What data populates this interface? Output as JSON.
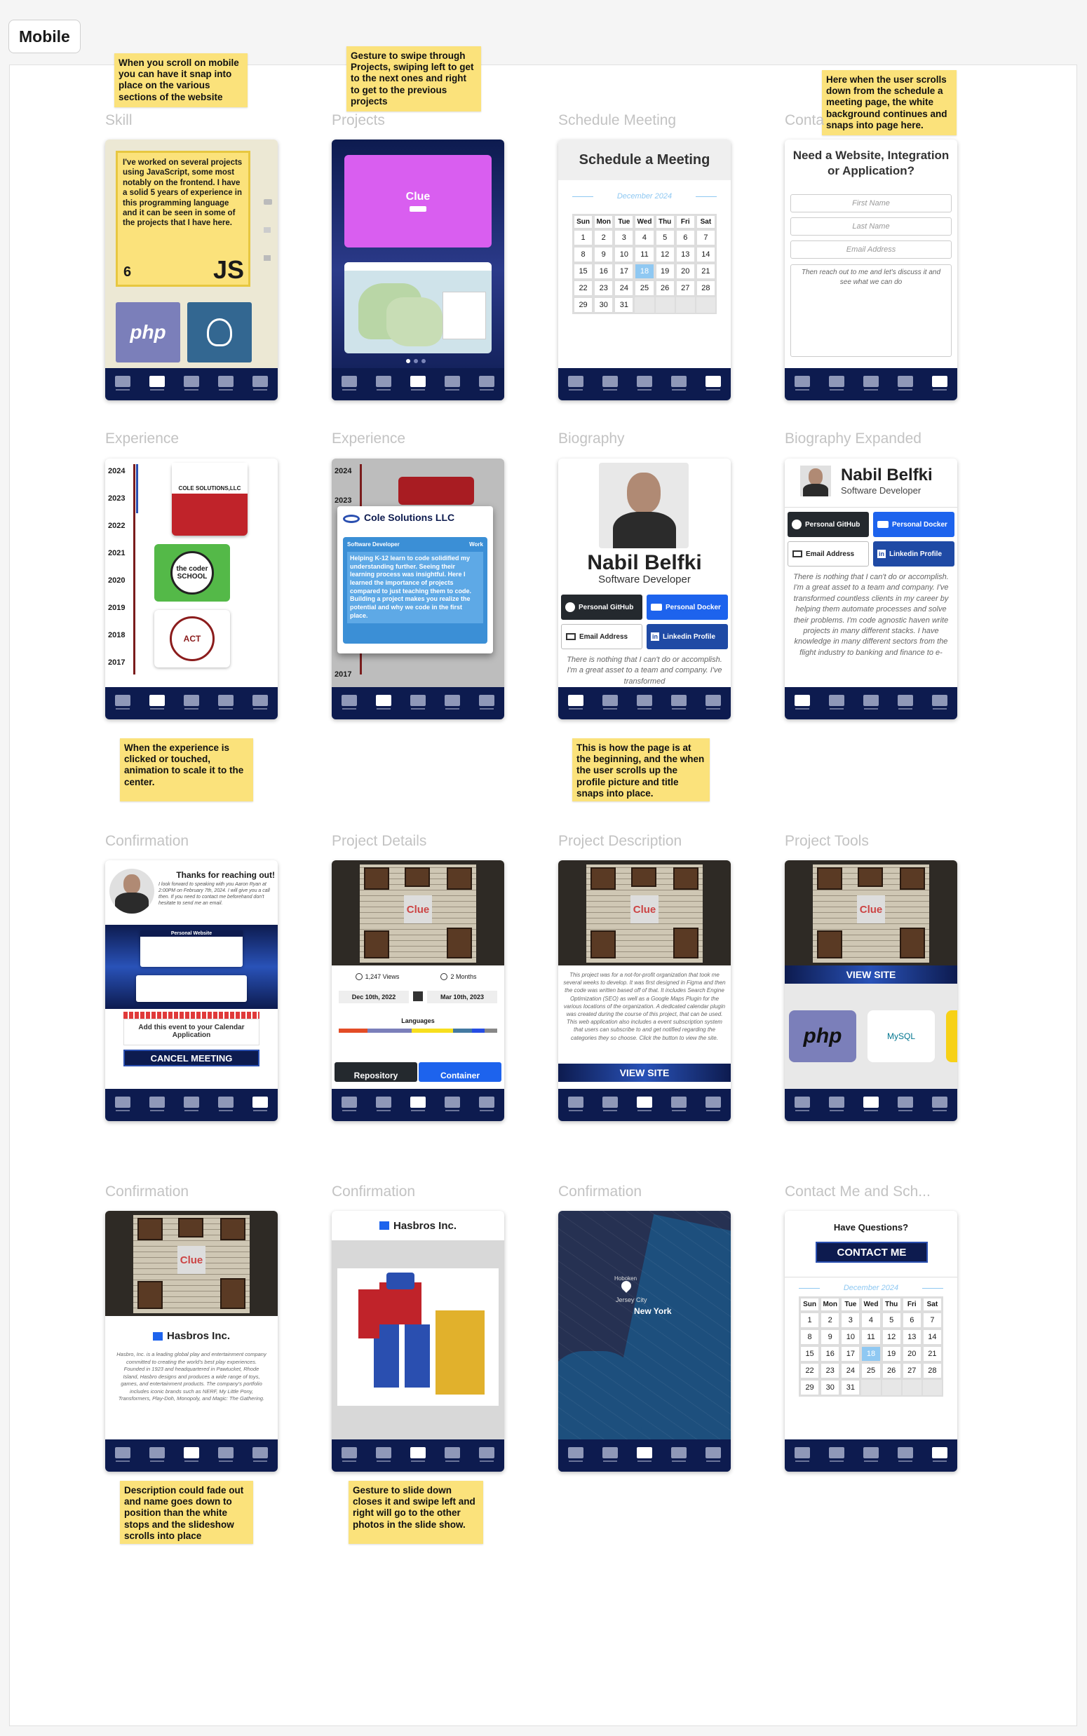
{
  "page_label": "Mobile",
  "nav_labels": [
    "BIOGRAPHY",
    "EXPERIENCE",
    "PROJECTS",
    "MEETING",
    "CONTACT"
  ],
  "frames": [
    {
      "title": "Skill"
    },
    {
      "title": "Projects"
    },
    {
      "title": "Schedule Meeting"
    },
    {
      "title": "Contact"
    },
    {
      "title": "Experience"
    },
    {
      "title": "Experience"
    },
    {
      "title": "Biography"
    },
    {
      "title": "Biography Expanded"
    },
    {
      "title": "Confirmation"
    },
    {
      "title": "Project Details"
    },
    {
      "title": "Project Description"
    },
    {
      "title": "Project Tools"
    },
    {
      "title": "Confirmation"
    },
    {
      "title": "Confirmation"
    },
    {
      "title": "Confirmation"
    },
    {
      "title": "Contact Me and Sch..."
    }
  ],
  "notes": {
    "snap": "When you scroll on mobile you can have it snap into place on the various sections of the website",
    "swipe": "Gesture to swipe through Projects, swiping left to get to the next ones and right to get to the previous projects",
    "contact_scroll": "Here when the user scrolls down from the schedule a meeting page, the white background continues and snaps into page here.",
    "experience": "When the experience is clicked or touched, animation to scale it to the center.",
    "biography": "This is how the page is at the beginning, and the when the user scrolls up the profile picture and title snaps into place.",
    "description": "Description could fade out and name goes down to position than the white stops and the slideshow scrolls into place",
    "slideshow": "Gesture to slide down closes it and swipe left and right will go to the other photos in the slide show."
  },
  "skill": {
    "text": "I've worked on several projects using JavaScript, some most notably on the frontend. I have a solid 5 years of experience in this programming language and it can be seen in some of the projects that I have here.",
    "count": "6",
    "badge": "JS",
    "tiles": [
      "php",
      "postgres-elephant"
    ]
  },
  "projects": {
    "card_title": "Clue"
  },
  "schedule": {
    "title": "Schedule a Meeting",
    "month": "December 2024",
    "days": [
      "Sun",
      "Mon",
      "Tue",
      "Wed",
      "Thu",
      "Fri",
      "Sat"
    ],
    "dates": [
      "1",
      "2",
      "3",
      "4",
      "5",
      "6",
      "7",
      "8",
      "9",
      "10",
      "11",
      "12",
      "13",
      "14",
      "15",
      "16",
      "17",
      "18",
      "19",
      "20",
      "21",
      "22",
      "23",
      "24",
      "25",
      "26",
      "27",
      "28",
      "29",
      "30",
      "31",
      "",
      "",
      "",
      ""
    ],
    "today": "18"
  },
  "contact": {
    "title": "Need a Website, Integration or Application?",
    "first_name": "First Name",
    "last_name": "Last Name",
    "email": "Email Address",
    "message": "Then reach out to me and let's discuss it and see what we can do"
  },
  "experience": {
    "years": [
      "2024",
      "2023",
      "2022",
      "2021",
      "2020",
      "2019",
      "2018",
      "2017"
    ],
    "logos": [
      "COLE SOLUTIONS,LLC",
      "the coder SCHOOL",
      "ACT"
    ],
    "popup_company": "Cole Solutions LLC",
    "popup_role": "Software Developer",
    "popup_type": "Work",
    "popup_text": "Helping K-12 learn to code solidified my understanding further. Seeing their learning process was insightful. Here I learned the importance of projects compared to just teaching them to code. Building a project makes you realize the potential and why we code in the first place."
  },
  "bio": {
    "name": "Nabil Belfki",
    "role": "Software Developer",
    "links": [
      {
        "label": "Personal GitHub",
        "color": "#24292e"
      },
      {
        "label": "Personal Docker",
        "color": "#1d63ed"
      },
      {
        "label": "Email Address",
        "color": "#ffffff"
      },
      {
        "label": "Linkedin Profile",
        "color": "#0a66c2"
      }
    ],
    "about": "There is nothing that I can't do or accomplish. I'm a great asset to a team and company. I've transformed",
    "about_expanded": "There is nothing that I can't do or accomplish. I'm a great asset to a team and company. I've transformed countless clients in my career by helping them automate processes and solve their problems. I'm code agnostic haven write projects in many different stacks. I have knowledge in many different sectors from the flight industry to banking and finance to e-"
  },
  "confirmation": {
    "title": "Thanks for reaching out!",
    "message": "I look forward to speaking with you Aaron Ryan at 2:00PM on February 7th, 2024. I will give you a call then. If you need to contact me beforehand don't hesitate to send me an email.",
    "calendar_text": "Add this event to your Calendar Application",
    "cancel": "CANCEL MEETING",
    "website_label": "Personal Website"
  },
  "project_details": {
    "views": "1,247 Views",
    "duration": "2 Months",
    "start": "Dec 10th, 2022",
    "end": "Mar 10th, 2023",
    "languages_title": "Languages",
    "repo": "Repository",
    "container": "Container"
  },
  "project_description": {
    "text": "This project was for a not-for-profit organization that took me several weeks to develop. It was first designed in Figma and then the code was written based off of that. It includes Search Engine Optimization (SEO) as well as a Google Maps Plugin for the various locations of the organization. A dedicated calendar plugin was created during the course of this project, that can be used. This web application also includes a event subscription system that users can subscribe to and get notified regarding the categories they so choose. Click the button to view the site.",
    "button": "VIEW SITE"
  },
  "project_tools": {
    "button": "VIEW SITE",
    "tools": [
      "php",
      "MySQL"
    ]
  },
  "hasbros": {
    "name": "Hasbros Inc.",
    "text": "Hasbro, Inc. is a leading global play and entertainment company committed to creating the world's best play experiences. Founded in 1923 and headquartered in Pawtucket, Rhode Island, Hasbro designs and produces a wide range of toys, games, and entertainment products. The company's portfolio includes iconic brands such as NERF, My Little Pony, Transformers, Play-Doh, Monopoly, and Magic: The Gathering."
  },
  "map": {
    "labels": [
      "New York",
      "Jersey City",
      "Hoboken"
    ]
  },
  "contact_schedule": {
    "question": "Have Questions?",
    "button": "CONTACT ME",
    "month": "December 2024"
  }
}
